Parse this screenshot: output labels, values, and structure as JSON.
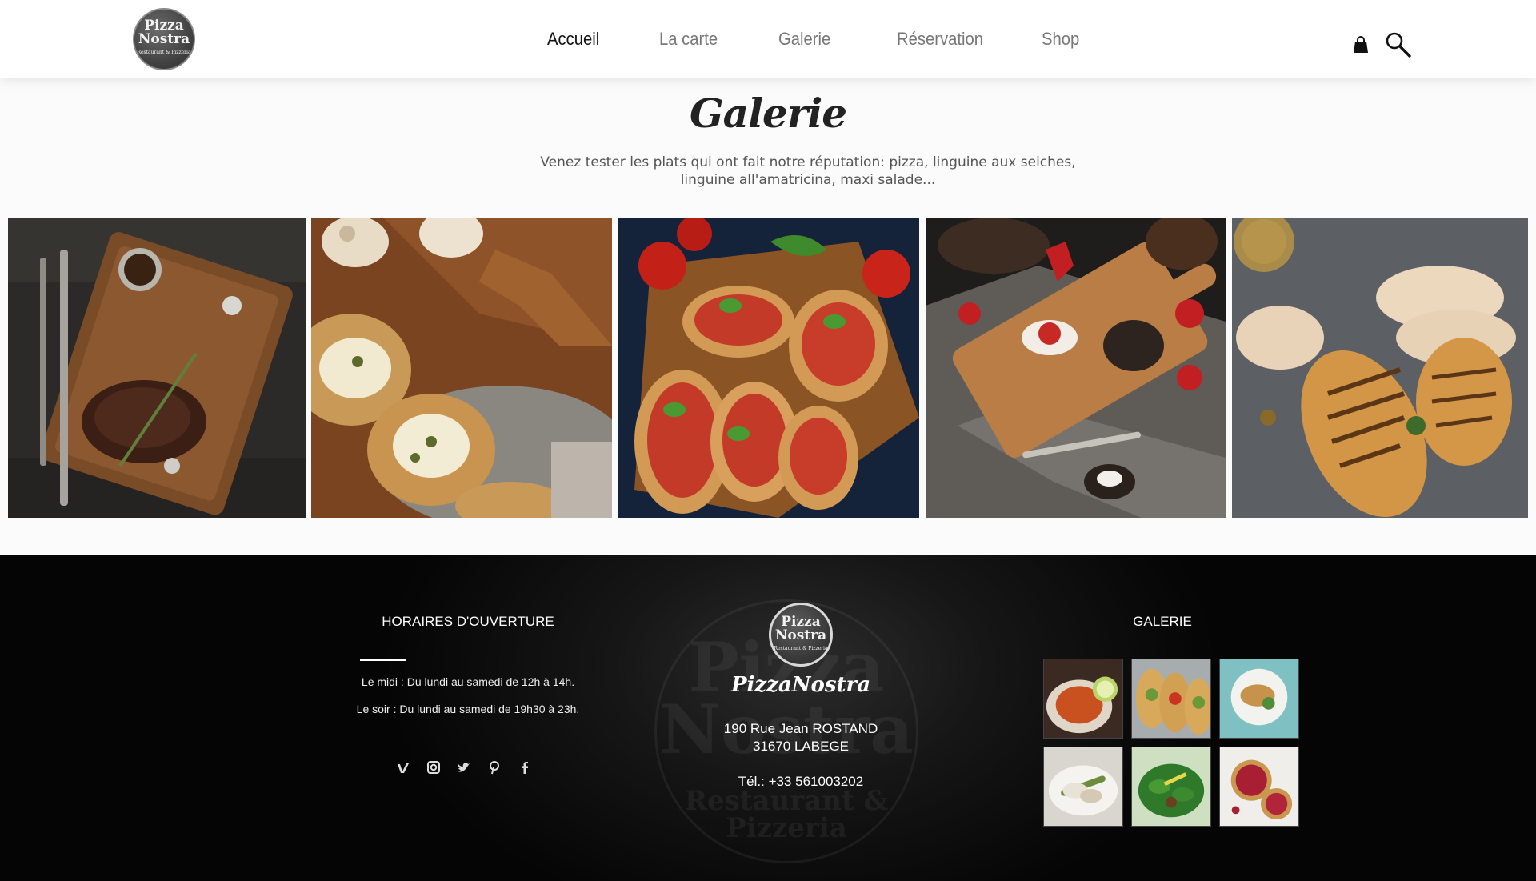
{
  "brand": {
    "logo_line1": "Pizza",
    "logo_line2": "Nostra",
    "logo_tagline": "Restaurant & Pizzeria"
  },
  "nav": {
    "items": [
      {
        "label": "Accueil",
        "active": true
      },
      {
        "label": "La carte",
        "active": false
      },
      {
        "label": "Galerie",
        "active": false
      },
      {
        "label": "Réservation",
        "active": false
      },
      {
        "label": "Shop",
        "active": false
      }
    ],
    "icons": [
      "shopping-bag-icon",
      "search-icon"
    ]
  },
  "gallery": {
    "title": "Galerie",
    "subtitle": "Venez tester les plats qui ont fait notre réputation: pizza, linguine aux seiches, linguine all'amatricina, maxi salade...",
    "photos": [
      "steak-board-photo",
      "bruschetta-capers-photo",
      "bruschetta-tomato-photo",
      "breakfast-board-photo",
      "grilled-chicken-photo"
    ]
  },
  "footer": {
    "hours": {
      "title": "HORAIRES D'OUVERTURE",
      "lines": [
        "Le midi : Du lundi au samedi de 12h à 14h.",
        "Le soir : Du lundi au samedi de 19h30 à 23h."
      ]
    },
    "social_icons": [
      "vimeo-icon",
      "instagram-icon",
      "twitter-icon",
      "pinterest-icon",
      "facebook-icon"
    ],
    "center": {
      "logo_line1": "Pizza",
      "logo_line2": "Nostra",
      "logo_tagline": "Restaurant & Pizzeria",
      "script_name": "PizzaNostra",
      "address_line1": "190 Rue Jean ROSTAND",
      "address_line2": "31670 LABEGE",
      "phone": "Tél.: +33 561003202"
    },
    "gallery": {
      "title": "GALERIE",
      "thumbs": [
        "shrimp-pasta-thumb",
        "tacos-thumb",
        "fish-plate-thumb",
        "asparagus-thumb",
        "spinach-salad-thumb",
        "berry-tart-thumb"
      ]
    }
  },
  "colors": {
    "header_bg": "#ffffff",
    "nav_active": "#111111",
    "nav_inactive": "#777777",
    "footer_bg": "#050505"
  }
}
